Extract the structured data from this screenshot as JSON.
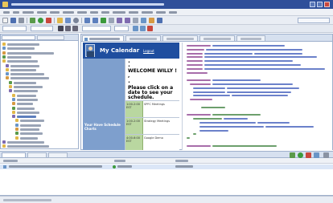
{
  "theme": {
    "title_blue": "#2f4f9a",
    "calendar_blue": "#1f4e9f",
    "sidebar_blue": "#7e9fcd",
    "meeting_green": "#b9d7a0",
    "code_blue": "#3a57b8",
    "code_purple": "#8a3c8e",
    "code_green": "#3b7f3b"
  },
  "preview": {
    "title": "My Calendar",
    "logout": "Logout",
    "welcome": "WELCOME WILLY ! ,",
    "instruction": "Please click on a date to see your schedule.",
    "sidebar_text": "Your Have Schedule Charts",
    "meetings": [
      {
        "time": "1:00-2:00 EST",
        "desc": "SPFC Meetings"
      },
      {
        "time": "1:00-2:00 EST",
        "desc": "Strategy Meetings"
      },
      {
        "time": "4:00-6:00 EST",
        "desc": "Google Demo"
      }
    ]
  },
  "icons": [
    "window-icon",
    "explorer-icon",
    "server-icon",
    "project-icon",
    "jsp-file-icon",
    "calendar-photo-icon"
  ]
}
